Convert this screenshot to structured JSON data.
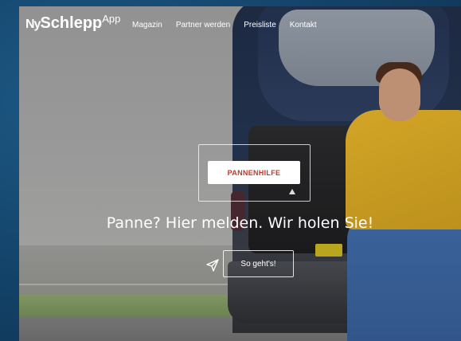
{
  "header": {
    "logo": {
      "ny": "Ny",
      "schlepp": "Schlepp",
      "app": "App"
    },
    "nav": [
      {
        "label": "Magazin"
      },
      {
        "label": "Partner werden"
      },
      {
        "label": "Preisliste"
      },
      {
        "label": "Kontakt"
      }
    ]
  },
  "hero": {
    "cta_label": "PANNENHILFE",
    "headline": "Panne? Hier melden. Wir holen Sie!",
    "how_label": "So geht's!"
  },
  "icons": {
    "warning": "warning-triangle-icon",
    "send": "paper-plane-icon"
  },
  "colors": {
    "cta_text": "#c0392b",
    "frame": "#163e5e"
  }
}
